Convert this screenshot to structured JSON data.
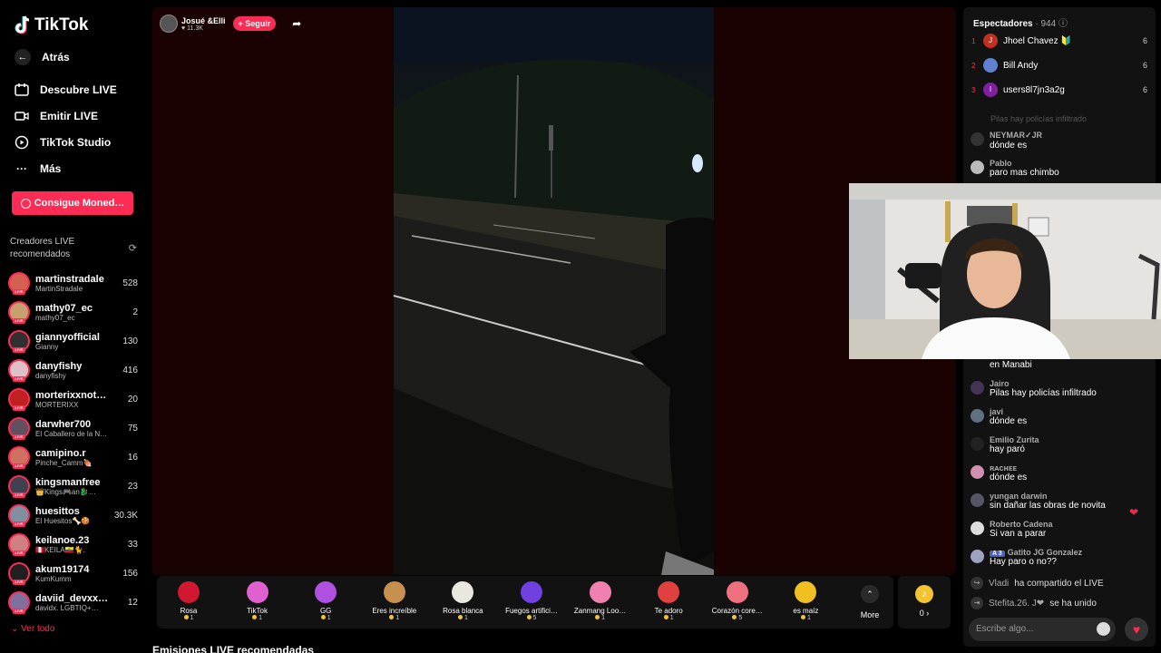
{
  "app": {
    "logo_text": "TikTok"
  },
  "nav": {
    "back": "Atrás",
    "items": [
      {
        "label": "Descubre LIVE",
        "icon": "calendar-live-icon"
      },
      {
        "label": "Emitir LIVE",
        "icon": "video-camera-icon"
      },
      {
        "label": "TikTok Studio",
        "icon": "studio-play-icon"
      },
      {
        "label": "Más",
        "icon": "more-dots-icon"
      }
    ],
    "coins_button": "Consigue Moned…"
  },
  "recommended": {
    "title": "Creadores LIVE recomendados",
    "creators": [
      {
        "name": "martinstradale",
        "sub": "MartinStradale",
        "count": "528"
      },
      {
        "name": "mathy07_ec",
        "sub": "mathy07_ec",
        "count": "2"
      },
      {
        "name": "giannyofficial",
        "sub": "Gianny",
        "count": "130"
      },
      {
        "name": "danyfishy",
        "sub": "danyfishy",
        "count": "416"
      },
      {
        "name": "morterixxnot…",
        "sub": "MORTERIXX",
        "count": "20"
      },
      {
        "name": "darwher700",
        "sub": "El Caballero de la N…",
        "count": "75"
      },
      {
        "name": "camipino.r",
        "sub": "Pinche_Camm🍖",
        "count": "16"
      },
      {
        "name": "kingsmanfree",
        "sub": "👑Kings🎮an🐉…",
        "count": "23"
      },
      {
        "name": "huesittos",
        "sub": "El Huesitos🦴🍪",
        "count": "30.3K"
      },
      {
        "name": "keilanoe.23",
        "sub": "🇵🇪KEILA🇪🇨🐈.",
        "count": "33"
      },
      {
        "name": "akum19174",
        "sub": "KumKumm",
        "count": "156"
      },
      {
        "name": "daviid_devxx…",
        "sub": "davidx. LGBTIQ+…",
        "count": "12"
      }
    ],
    "see_all": "Ver todo"
  },
  "stream": {
    "host_name": "Josué &Elli",
    "host_likes": "♥ 11.3K",
    "follow": "+ Seguir"
  },
  "gifts": [
    {
      "name": "Rosa",
      "price": "1",
      "color": "#d01830"
    },
    {
      "name": "TikTok",
      "price": "1",
      "color": "#e060d0"
    },
    {
      "name": "GG",
      "price": "1",
      "color": "#b050e0"
    },
    {
      "name": "Eres increíble",
      "price": "1",
      "color": "#c89050"
    },
    {
      "name": "Rosa blanca",
      "price": "1",
      "color": "#e8e8e0"
    },
    {
      "name": "Fuegos artifici…",
      "price": "5",
      "color": "#7040e0"
    },
    {
      "name": "Zanmang Loo…",
      "price": "1",
      "color": "#f080b0"
    },
    {
      "name": "Te adoro",
      "price": "1",
      "color": "#e04040"
    },
    {
      "name": "Corazón core…",
      "price": "5",
      "color": "#f07080"
    },
    {
      "name": "es maíz",
      "price": "1",
      "color": "#f0c020"
    }
  ],
  "more_label": "More",
  "wallet_label": "0 ›",
  "recommended_lives": "Emisiones LIVE recomendadas",
  "chat": {
    "viewers_title": "Espectadores",
    "viewers_count": "· 944",
    "top_viewers": [
      {
        "rank": "1",
        "initial": "J",
        "name": "Jhoel Chavez 🔰",
        "count": "6",
        "color": "#c03020"
      },
      {
        "rank": "2",
        "initial": "",
        "name": "Bill Andy",
        "count": "6",
        "color": "#6080d0"
      },
      {
        "rank": "3",
        "initial": "I",
        "name": "users8l7jn3a2g",
        "count": "6",
        "color": "#8020a0"
      }
    ],
    "faded": "Pilas hay policías infiltrado",
    "messages_top": [
      {
        "user": "NEYMAR✓JR",
        "text": "dónde es",
        "color": "#333"
      },
      {
        "user": "Pablo",
        "text": "paro mas chimbo",
        "color": "#bbb"
      }
    ],
    "messages": [
      {
        "user": "",
        "text": "en Manabi",
        "color": "#333"
      },
      {
        "user": "Jairo",
        "text": "Pilas hay policías infiltrado",
        "color": "#443355"
      },
      {
        "user": "javi",
        "text": "dónde es",
        "color": "#607080"
      },
      {
        "user": "Emilio Zurita",
        "text": "hay paró",
        "color": "#222"
      },
      {
        "user": "ʀᴀᴄʜᴇᴇ",
        "text": "dónde es",
        "color": "#d090b0"
      },
      {
        "user": "yungan darwin",
        "text": "sin dañar las obras de novita",
        "color": "#556"
      },
      {
        "user": "Roberto Cadena",
        "text": "Si van a parar",
        "color": "#ddd"
      },
      {
        "user": "Gatito JG Gonzalez",
        "text": "Hay paro o no??",
        "color": "#a0a0c0"
      }
    ],
    "level_badge": "A 3",
    "system": [
      {
        "user": "Vladi",
        "text": "ha compartido el LIVE"
      },
      {
        "user": "Stefita.26. J❤",
        "text": "se ha unido"
      }
    ],
    "input_placeholder": "Escribe algo..."
  }
}
